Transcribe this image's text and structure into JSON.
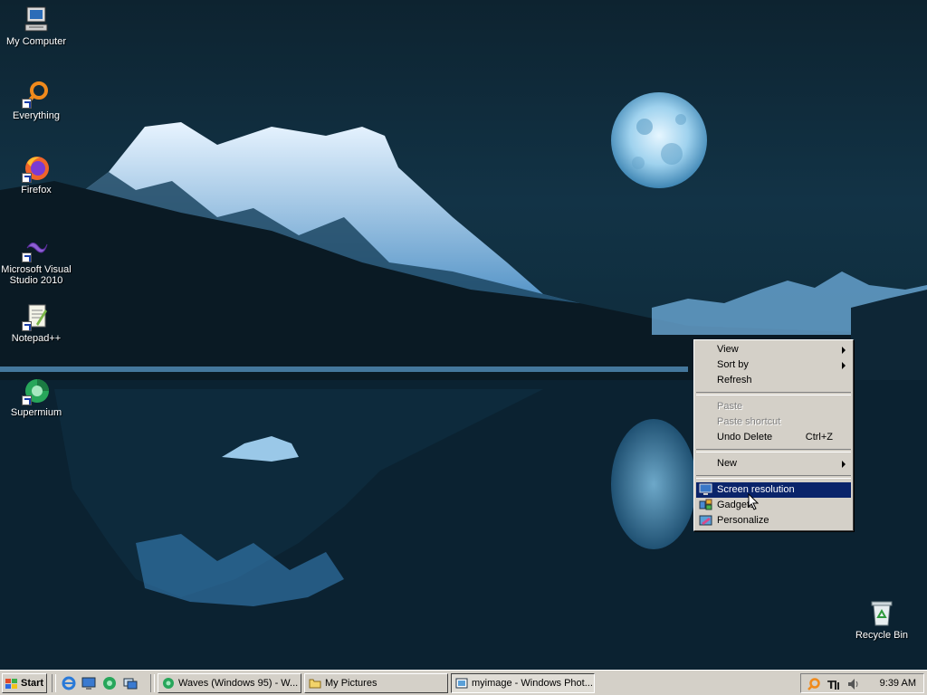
{
  "desktop": {
    "icons": [
      {
        "label": "My Computer",
        "icon": "computer-icon"
      },
      {
        "label": "Everything",
        "icon": "everything-search-icon"
      },
      {
        "label": "Firefox",
        "icon": "firefox-icon"
      },
      {
        "label": "Microsoft Visual Studio 2010",
        "icon": "visual-studio-icon"
      },
      {
        "label": "Notepad++",
        "icon": "notepad-plus-plus-icon"
      },
      {
        "label": "Supermium",
        "icon": "supermium-icon"
      },
      {
        "label": "Recycle Bin",
        "icon": "recycle-bin-icon"
      }
    ]
  },
  "context_menu": {
    "items": [
      {
        "label": "View",
        "submenu": true
      },
      {
        "label": "Sort by",
        "submenu": true
      },
      {
        "label": "Refresh"
      },
      {
        "label": "Paste",
        "disabled": true
      },
      {
        "label": "Paste shortcut",
        "disabled": true
      },
      {
        "label": "Undo Delete",
        "shortcut": "Ctrl+Z"
      },
      {
        "label": "New",
        "submenu": true
      },
      {
        "label": "Screen resolution",
        "selected": true,
        "icon": "monitor-icon"
      },
      {
        "label": "Gadgets",
        "icon": "gadgets-icon"
      },
      {
        "label": "Personalize",
        "icon": "personalize-icon"
      }
    ]
  },
  "taskbar": {
    "start_label": "Start",
    "quick_launch": [
      "internet-explorer-icon",
      "show-desktop-icon",
      "supermium-icon",
      "window-switcher-icon"
    ],
    "tasks": [
      {
        "label": "Waves (Windows 95) - W...",
        "icon": "supermium-icon"
      },
      {
        "label": "My Pictures",
        "icon": "folder-icon"
      },
      {
        "label": "myimage - Windows Phot...",
        "icon": "photo-viewer-icon",
        "active": true
      }
    ],
    "tray_icons": [
      "everything-search-icon",
      "input-language-icon",
      "volume-icon"
    ],
    "clock": "9:39 AM"
  },
  "colors": {
    "menu_face": "#d4d0c8",
    "menu_highlight": "#0a246a",
    "desktop_sky": "#123346",
    "desktop_water": "#0b2434",
    "moon": "#a8d8f0"
  }
}
